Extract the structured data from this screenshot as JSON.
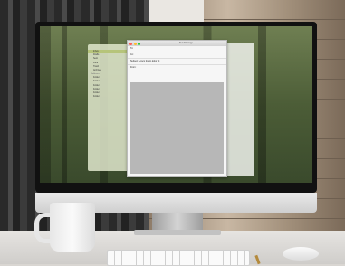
{
  "compose": {
    "title": "New Message",
    "to_label": "To:",
    "cc_label": "Cc:",
    "subject_label": "Subject:",
    "subject_value": "Lorem Ipsum dolor sit",
    "from_label": "From:"
  },
  "sidebar": {
    "items": [
      {
        "label": "Inbox"
      },
      {
        "label": "Drafts"
      },
      {
        "label": "Sent"
      },
      {
        "label": "Junk"
      },
      {
        "label": "Trash"
      },
      {
        "label": "Archive"
      }
    ],
    "section": "Mailboxes",
    "sub_items": [
      {
        "label": "Folder"
      },
      {
        "label": "Folder"
      },
      {
        "label": "Folder"
      },
      {
        "label": "Folder"
      },
      {
        "label": "Folder"
      },
      {
        "label": "Folder"
      }
    ]
  },
  "colors": {
    "window_close": "#ff5f57",
    "window_min": "#febc2e",
    "window_max": "#28c840"
  }
}
